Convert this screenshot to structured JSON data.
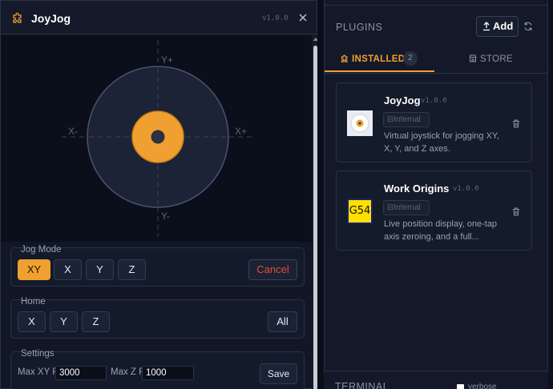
{
  "colors": {
    "accent": "#f0a030",
    "danger": "#e8493a",
    "background": "#0c1120"
  },
  "window": {
    "icon": "puzzle-icon",
    "title": "JoyJog",
    "version": "v1.0.0",
    "close_icon": "close-icon"
  },
  "joystick": {
    "y_plus": "Y+",
    "y_minus": "Y-",
    "x_minus": "X-",
    "x_plus": "X+"
  },
  "jog_mode": {
    "label": "Jog Mode",
    "modes": [
      "XY",
      "X",
      "Y",
      "Z"
    ],
    "active": "XY",
    "cancel": "Cancel"
  },
  "home": {
    "label": "Home",
    "buttons": [
      "X",
      "Y",
      "Z"
    ],
    "all": "All"
  },
  "settings": {
    "label": "Settings",
    "max_xy_label": "Max XY F",
    "max_xy_value": "3000",
    "max_z_label": "Max Z F",
    "max_z_value": "1000",
    "save": "Save"
  },
  "plugins": {
    "title": "PLUGINS",
    "add_label": "Add",
    "tabs": [
      {
        "label": "INSTALLED",
        "icon": "puzzle-icon",
        "count": "2",
        "active": true
      },
      {
        "label": "STORE",
        "icon": "store-icon",
        "active": false
      }
    ],
    "items": [
      {
        "name": "JoyJog",
        "version": "v1.0.0",
        "badge": "Internal",
        "description": "Virtual joystick for jogging XY, X, Y, and Z axes.",
        "thumb": "joystick-thumb"
      },
      {
        "name": "Work Origins",
        "version": "v1.0.0",
        "badge": "Internal",
        "description": "Live position display, one-tap axis zeroing, and a full...",
        "thumb_text": "G54"
      }
    ]
  },
  "terminal": {
    "title": "TERMINAL",
    "verbose_label": "verbose"
  }
}
